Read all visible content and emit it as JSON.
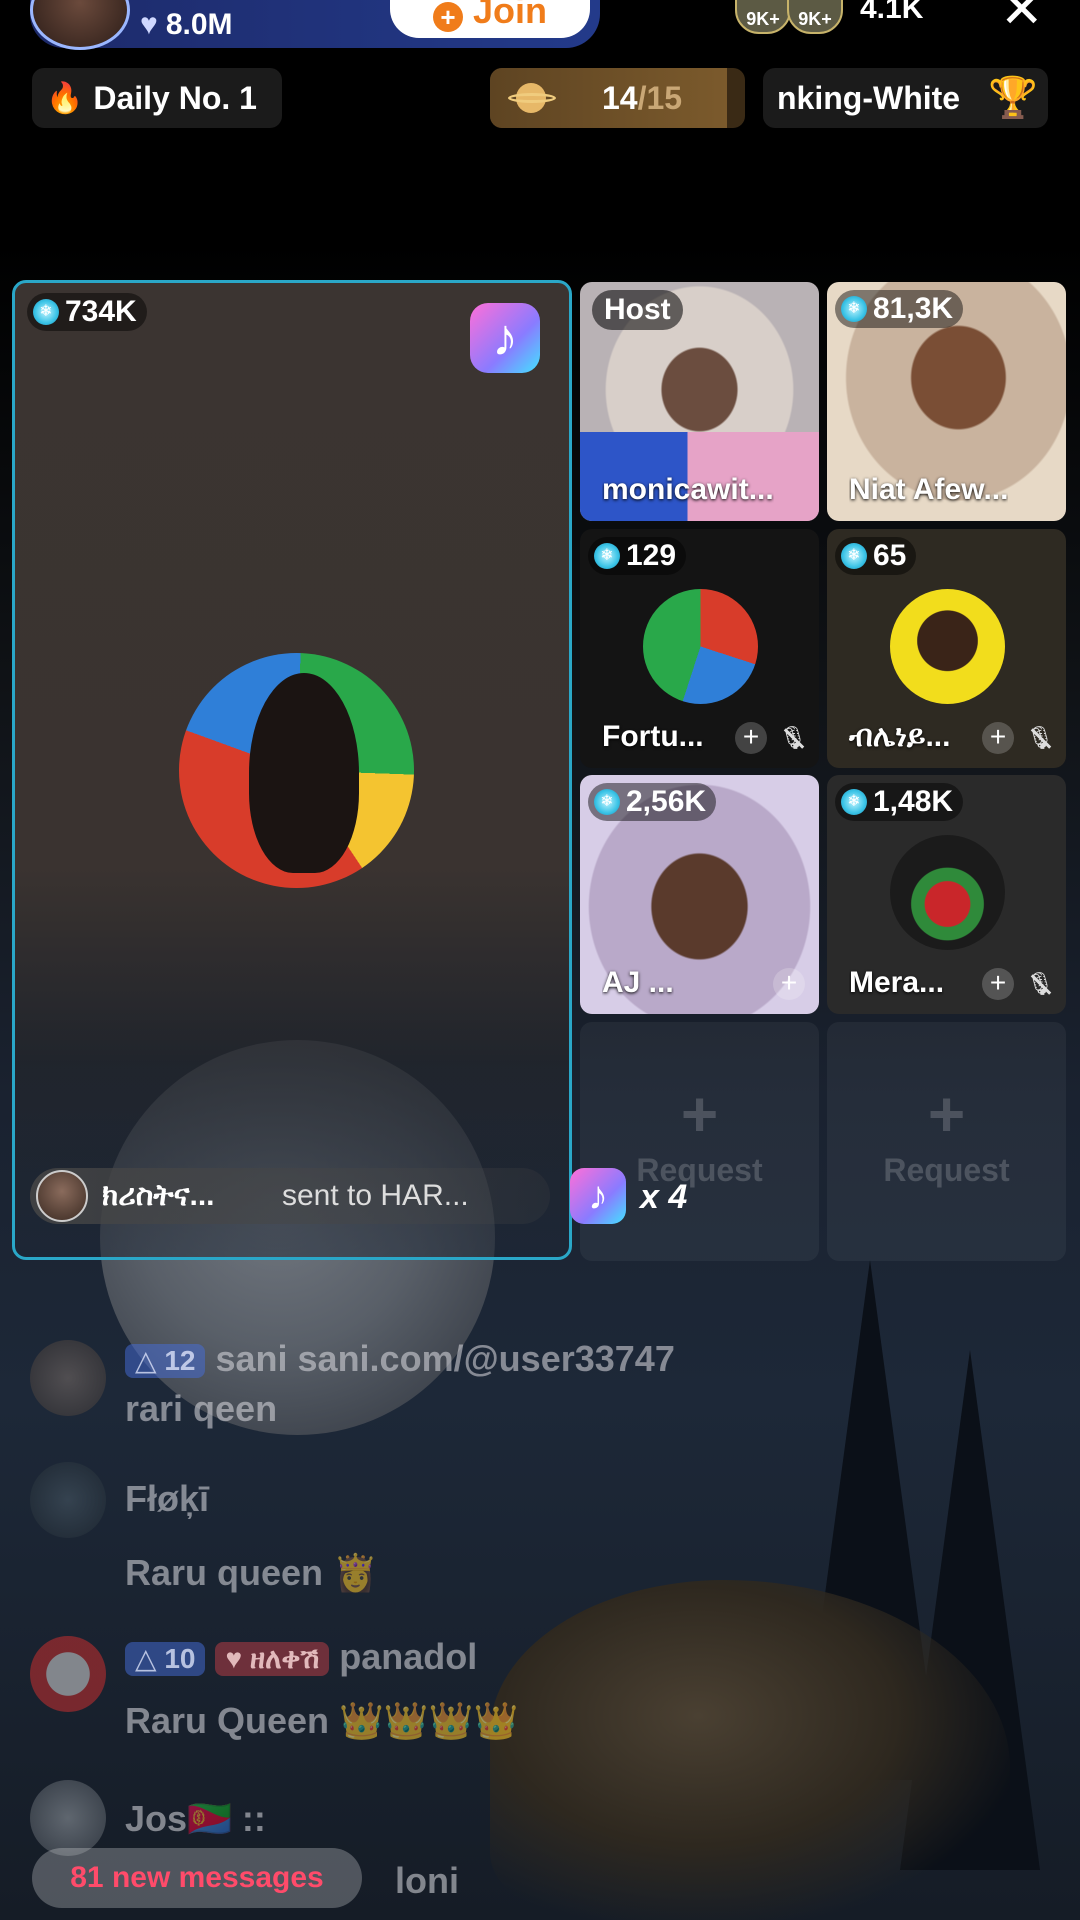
{
  "header": {
    "likes": "8.0M",
    "join_label": "Join",
    "viewer_badges": [
      "9K+",
      "9K+"
    ],
    "viewer_count": "4.1K",
    "close_icon": "close-icon"
  },
  "pills": {
    "daily_rank": "Daily No. 1",
    "progress_current": "14",
    "progress_total": "/15",
    "progress_fraction": 0.93,
    "ranking_text": "nking-White"
  },
  "main_tile": {
    "score": "734K"
  },
  "tiles": [
    {
      "label": "Host",
      "name": "monicawit..."
    },
    {
      "score": "81,3K",
      "name": "Niat Afew..."
    },
    {
      "score": "129",
      "name": "Fortu..."
    },
    {
      "score": "65",
      "name": "ብሌነይ..."
    },
    {
      "score": "2,56K",
      "name": "AJ ... "
    },
    {
      "score": "1,48K",
      "name": "Mera..."
    }
  ],
  "request_label": "Request",
  "gift": {
    "sender": "ክሪስትና...",
    "text": "sent to HAR...",
    "count": "x 4"
  },
  "chat": [
    {
      "level": "12",
      "user": "sani sani.com/@user33747",
      "message": "rari qeen"
    },
    {
      "user": "Fłøķī",
      "message": "Raru queen 👸"
    },
    {
      "level": "10",
      "fan": "ዘለቀሽ",
      "user": "panadol",
      "message": "Raru Queen 👑👑👑👑"
    },
    {
      "user": "Jos🇪🇷 ::",
      "message": "loni"
    }
  ],
  "new_messages": "81 new messages",
  "colors": {
    "accent_border": "#2aa7c8",
    "join_text": "#f07c1a",
    "new_messages": "#ff4b6a"
  }
}
